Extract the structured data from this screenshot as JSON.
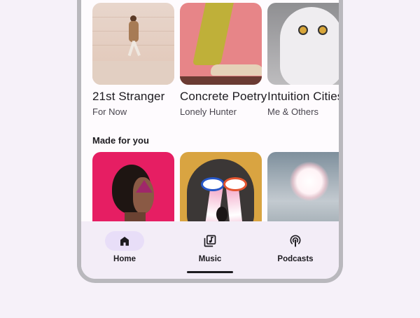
{
  "recent": [
    {
      "title": "21st Stranger",
      "subtitle": "For Now",
      "art": "person-walking-by-wall"
    },
    {
      "title": "Concrete Poetry",
      "subtitle": "Lonely Hunter",
      "art": "legs-and-shoe-on-pink"
    },
    {
      "title": "Intuition Cities",
      "subtitle": "Me & Others",
      "art": "snowy-owl"
    }
  ],
  "made_for_you": {
    "title": "Made for you",
    "items": [
      {
        "art": "woman-portrait-pink"
      },
      {
        "art": "face-with-beaming-eyes"
      },
      {
        "art": "sun-in-clouds"
      }
    ]
  },
  "nav": {
    "items": [
      {
        "label": "Home",
        "icon": "home-icon",
        "active": true
      },
      {
        "label": "Music",
        "icon": "music-library-icon",
        "active": false
      },
      {
        "label": "Podcasts",
        "icon": "podcast-icon",
        "active": false
      }
    ]
  },
  "colors": {
    "background": "#f6f1f9",
    "surface": "#fefbfe",
    "nav_bar": "#f3edf7",
    "active_indicator": "#e8def8",
    "on_surface": "#1d1b20",
    "on_surface_variant": "#49454f"
  }
}
